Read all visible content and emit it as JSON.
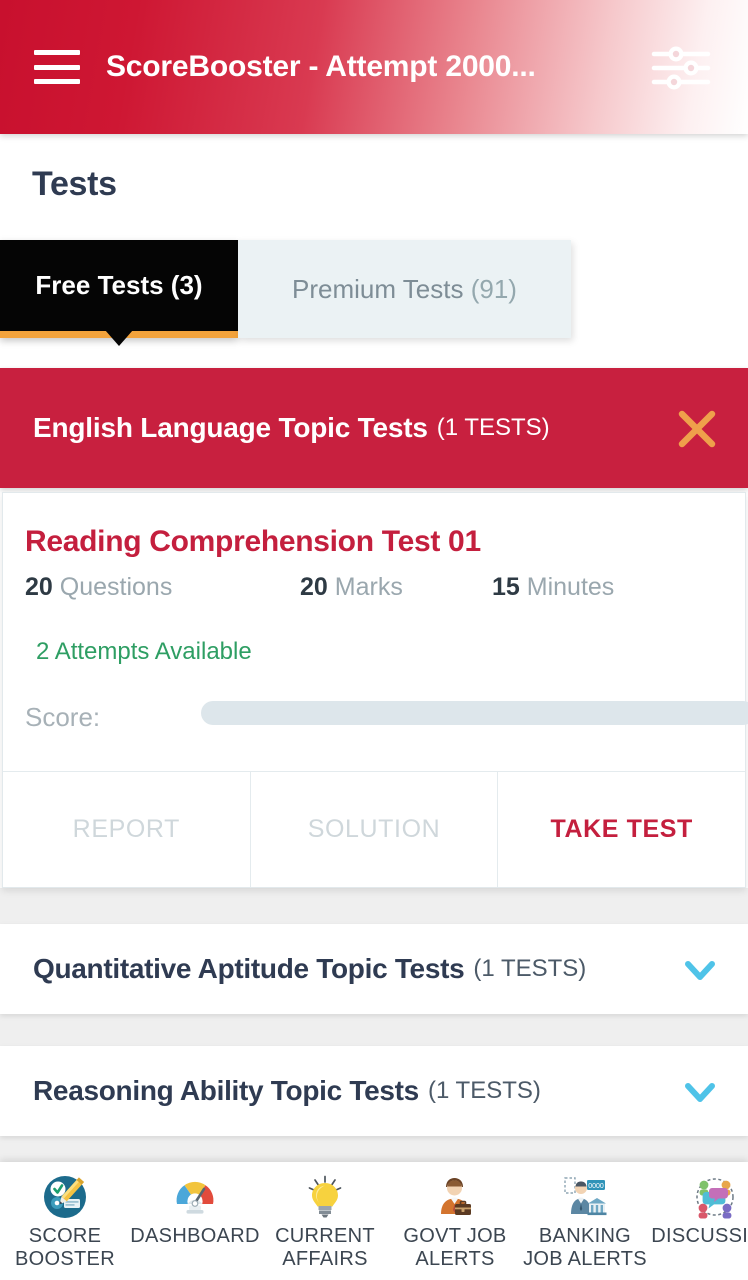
{
  "colors": {
    "brand_red": "#C8102E",
    "group_red": "#C8203F",
    "title_red": "#C41F3E",
    "accent_orange": "#F3A33C",
    "close_orange": "#EFA04B",
    "chevron_blue": "#4FC3E8",
    "green": "#2E9E63",
    "navy": "#2F3B52",
    "tab_inactive_bg": "#EBF2F4",
    "score_track": "#DDE6EB"
  },
  "appbar": {
    "menu_icon": "hamburger-menu-icon",
    "title": "ScoreBooster - Attempt 2000...",
    "filter_icon": "filter-sliders-icon"
  },
  "page": {
    "title": "Tests"
  },
  "tabs": [
    {
      "label": "Free Tests",
      "count": "(3)",
      "active": true,
      "name": "tab-free-tests"
    },
    {
      "label": "Premium Tests",
      "count": "(91)",
      "active": false,
      "name": "tab-premium-tests"
    }
  ],
  "expanded_group": {
    "title": "English Language Topic Tests",
    "count": "(1 TESTS)",
    "close_icon": "close-x-icon"
  },
  "test_card": {
    "title": "Reading Comprehension Test 01",
    "stats": [
      {
        "value": "20",
        "label": "Questions"
      },
      {
        "value": "20",
        "label": "Marks"
      },
      {
        "value": "15",
        "label": "Minutes"
      }
    ],
    "attempts": "2 Attempts Available",
    "score_label": "Score:",
    "score_percent": 0,
    "actions": [
      {
        "label": "REPORT",
        "state": "disabled"
      },
      {
        "label": "SOLUTION",
        "state": "disabled"
      },
      {
        "label": "TAKE TEST",
        "state": "primary"
      }
    ]
  },
  "collapsed_groups": [
    {
      "title": "Quantitative Aptitude Topic Tests",
      "count": "(1 TESTS)",
      "chevron": "chevron-down-icon"
    },
    {
      "title": "Reasoning Ability Topic Tests",
      "count": "(1 TESTS)",
      "chevron": "chevron-down-icon"
    },
    {
      "title": "",
      "count": "",
      "chevron": "chevron-down-icon"
    }
  ],
  "bottom_nav": [
    {
      "label": "SCORE\nBOOSTER",
      "icon": "score-booster-icon"
    },
    {
      "label": "DASHBOARD",
      "icon": "dashboard-gauge-icon"
    },
    {
      "label": "CURRENT\nAFFAIRS",
      "icon": "lightbulb-icon"
    },
    {
      "label": "GOVT JOB\nALERTS",
      "icon": "job-person-briefcase-icon"
    },
    {
      "label": "BANKING\nJOB ALERTS",
      "icon": "banking-job-icon"
    },
    {
      "label": "DISCUSSION",
      "icon": "discussion-chat-icon"
    }
  ]
}
